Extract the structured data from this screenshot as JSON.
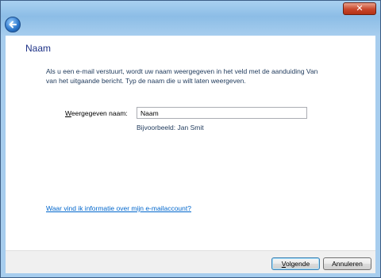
{
  "window": {
    "close_label": "✕"
  },
  "page": {
    "heading": "Naam",
    "intro": "Als u een e-mail verstuurt, wordt uw naam weergegeven in het veld met de aanduiding Van van het uitgaande bericht. Typ de naam die u wilt laten weergeven.",
    "display_name_label_mnemonic": "W",
    "display_name_label_rest": "eergegeven naam:",
    "display_name_value": "Naam",
    "example": "Bijvoorbeeld: Jan Smit",
    "help_link": "Waar vind ik informatie over mijn e-mailaccount?"
  },
  "footer": {
    "next_mnemonic": "V",
    "next_rest": "olgende",
    "cancel_label": "Annuleren"
  },
  "icons": {
    "back": "back-arrow-icon",
    "close": "close-icon"
  }
}
